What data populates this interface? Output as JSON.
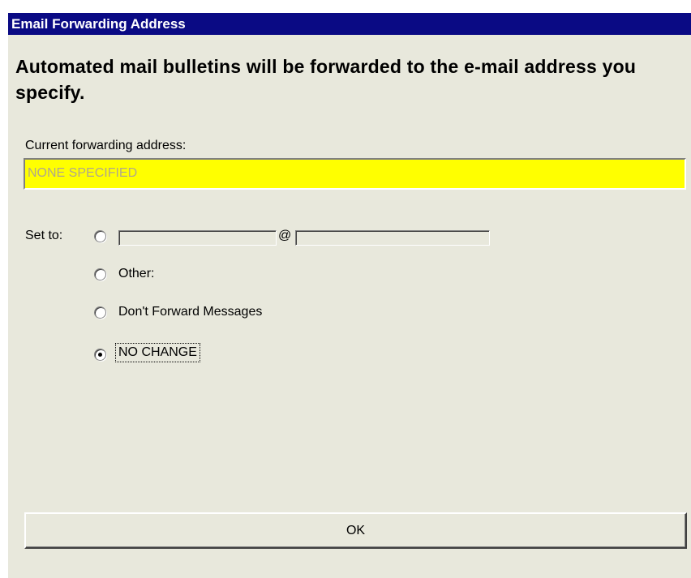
{
  "window": {
    "title": "Email Forwarding Address"
  },
  "heading": "Automated mail bulletins will be forwarded to the e-mail address you specify.",
  "current": {
    "label": "Current forwarding address:",
    "value": "NONE SPECIFIED"
  },
  "set_to": {
    "label": "Set to:",
    "at_sign": "@",
    "username_value": "",
    "domain_value": "",
    "options": [
      {
        "label": "",
        "checked": false
      },
      {
        "label": "Other:",
        "checked": false
      },
      {
        "label": "Don't Forward Messages",
        "checked": false
      },
      {
        "label": "NO CHANGE",
        "checked": true
      }
    ]
  },
  "ok_button": {
    "label": "OK"
  },
  "colors": {
    "titlebar": "#0a0a84",
    "dialog_bg": "#e8e8dc",
    "highlight_field": "#ffff00",
    "disabled_text": "#b0a88a"
  }
}
